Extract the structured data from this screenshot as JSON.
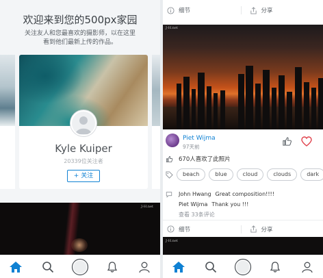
{
  "left": {
    "welcome_title": "欢迎来到您的500px家园",
    "welcome_subtitle": "关注友人和您最喜欢的摄影师，以在这里看到他们最新上传的作品。",
    "card": {
      "name": "Kyle Kuiper",
      "followers": "20339位关注者",
      "follow_button": "+ 关注"
    },
    "photo_watermark": "J-H.net"
  },
  "right": {
    "action_bar": {
      "details": "细节",
      "share": "分享"
    },
    "photo_watermark": "J-H.net",
    "post": {
      "author": "Piet Wijma",
      "time": "97天前",
      "likes": "670人喜欢了此照片",
      "tags": [
        "beach",
        "blue",
        "cloud",
        "clouds",
        "dark"
      ],
      "comments": [
        {
          "user": "John Hwang",
          "text": "Great composition!!!!"
        },
        {
          "user": "Piet Wijma",
          "text": "Thank you !!!"
        }
      ],
      "view_comments": "查看 33条评论"
    },
    "bottom_watermark": "J-H.net"
  },
  "tabbar": {
    "items": [
      "home-icon",
      "search-icon",
      "camera-icon",
      "notifications-icon",
      "profile-icon"
    ],
    "active": "home-icon"
  },
  "colors": {
    "accent": "#0f81d3",
    "like_heart": "#e0414b"
  }
}
